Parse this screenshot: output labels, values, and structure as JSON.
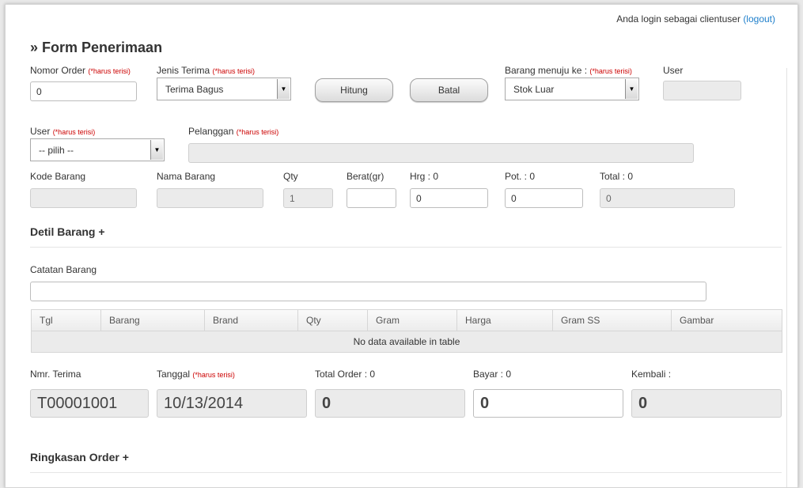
{
  "header": {
    "login_text": "Anda login sebagai clientuser",
    "logout_link": "(logout)"
  },
  "form": {
    "title": "» Form Penerimaan",
    "required_note": "(*harus terisi)",
    "nomor_order": {
      "label": "Nomor Order",
      "value": "0"
    },
    "jenis_terima": {
      "label": "Jenis Terima",
      "value": "Terima Bagus"
    },
    "hitung_button": "Hitung",
    "batal_button": "Batal",
    "barang_menuju": {
      "label": "Barang menuju ke :",
      "value": "Stok Luar"
    },
    "user_top": {
      "label": "User",
      "value": ""
    },
    "user_select": {
      "label": "User",
      "value": "-- pilih --"
    },
    "pelanggan": {
      "label": "Pelanggan",
      "value": ""
    },
    "kode_barang": {
      "label": "Kode Barang",
      "value": ""
    },
    "nama_barang": {
      "label": "Nama Barang",
      "value": ""
    },
    "qty": {
      "label": "Qty",
      "value": "1"
    },
    "berat": {
      "label": "Berat(gr)",
      "value": ""
    },
    "hrg": {
      "label": "Hrg : 0",
      "value": "0"
    },
    "pot": {
      "label": "Pot. : 0",
      "value": "0"
    },
    "total": {
      "label": "Total : 0",
      "value": "0"
    },
    "detil_barang": "Detil Barang +",
    "catatan_barang": {
      "label": "Catatan Barang",
      "value": ""
    }
  },
  "table": {
    "columns": [
      "Tgl",
      "Barang",
      "Brand",
      "Qty",
      "Gram",
      "Harga",
      "Gram SS",
      "Gambar"
    ],
    "empty_message": "No data available in table"
  },
  "summary": {
    "nmr_terima": {
      "label": "Nmr. Terima",
      "value": "T00001001"
    },
    "tanggal": {
      "label": "Tanggal",
      "value": "10/13/2014"
    },
    "total_order": {
      "label": "Total Order : 0",
      "value": "0"
    },
    "bayar": {
      "label": "Bayar : 0",
      "value": "0"
    },
    "kembali": {
      "label": "Kembali :",
      "value": "0"
    },
    "ringkasan_order": "Ringkasan Order +"
  }
}
